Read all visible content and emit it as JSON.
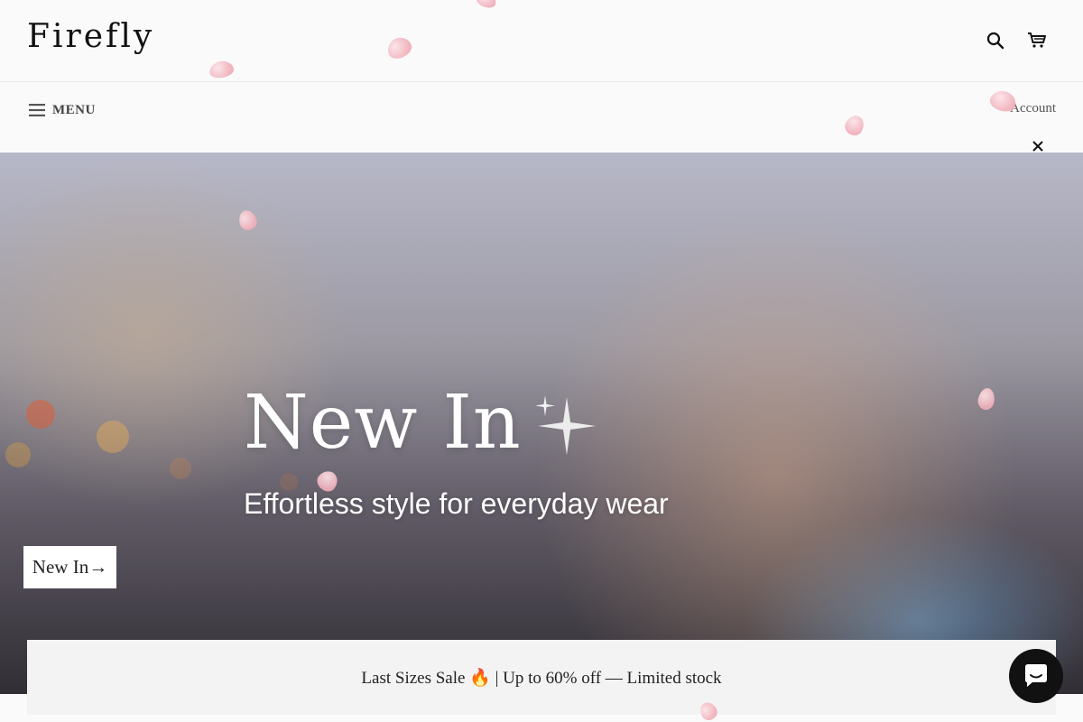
{
  "header": {
    "logo": "Firefly",
    "search_icon": "search-icon",
    "cart_icon": "cart-icon"
  },
  "nav": {
    "menu_label": "MENU",
    "menu_icon": "hamburger-icon",
    "account_label": "Account",
    "close_icon": "close-icon"
  },
  "hero": {
    "title": "New In",
    "sparkle_icon": "sparkle-icon",
    "subtitle": "Effortless style for everyday wear",
    "cta_label": "New In→"
  },
  "announcement": {
    "text": "Last Sizes Sale 🔥 | Up to 60% off — Limited stock"
  },
  "chat": {
    "icon": "chat-icon"
  },
  "colors": {
    "accent": "#111111",
    "petal": "#f0aeb9",
    "announcement_bg": "#f3f3f3"
  }
}
